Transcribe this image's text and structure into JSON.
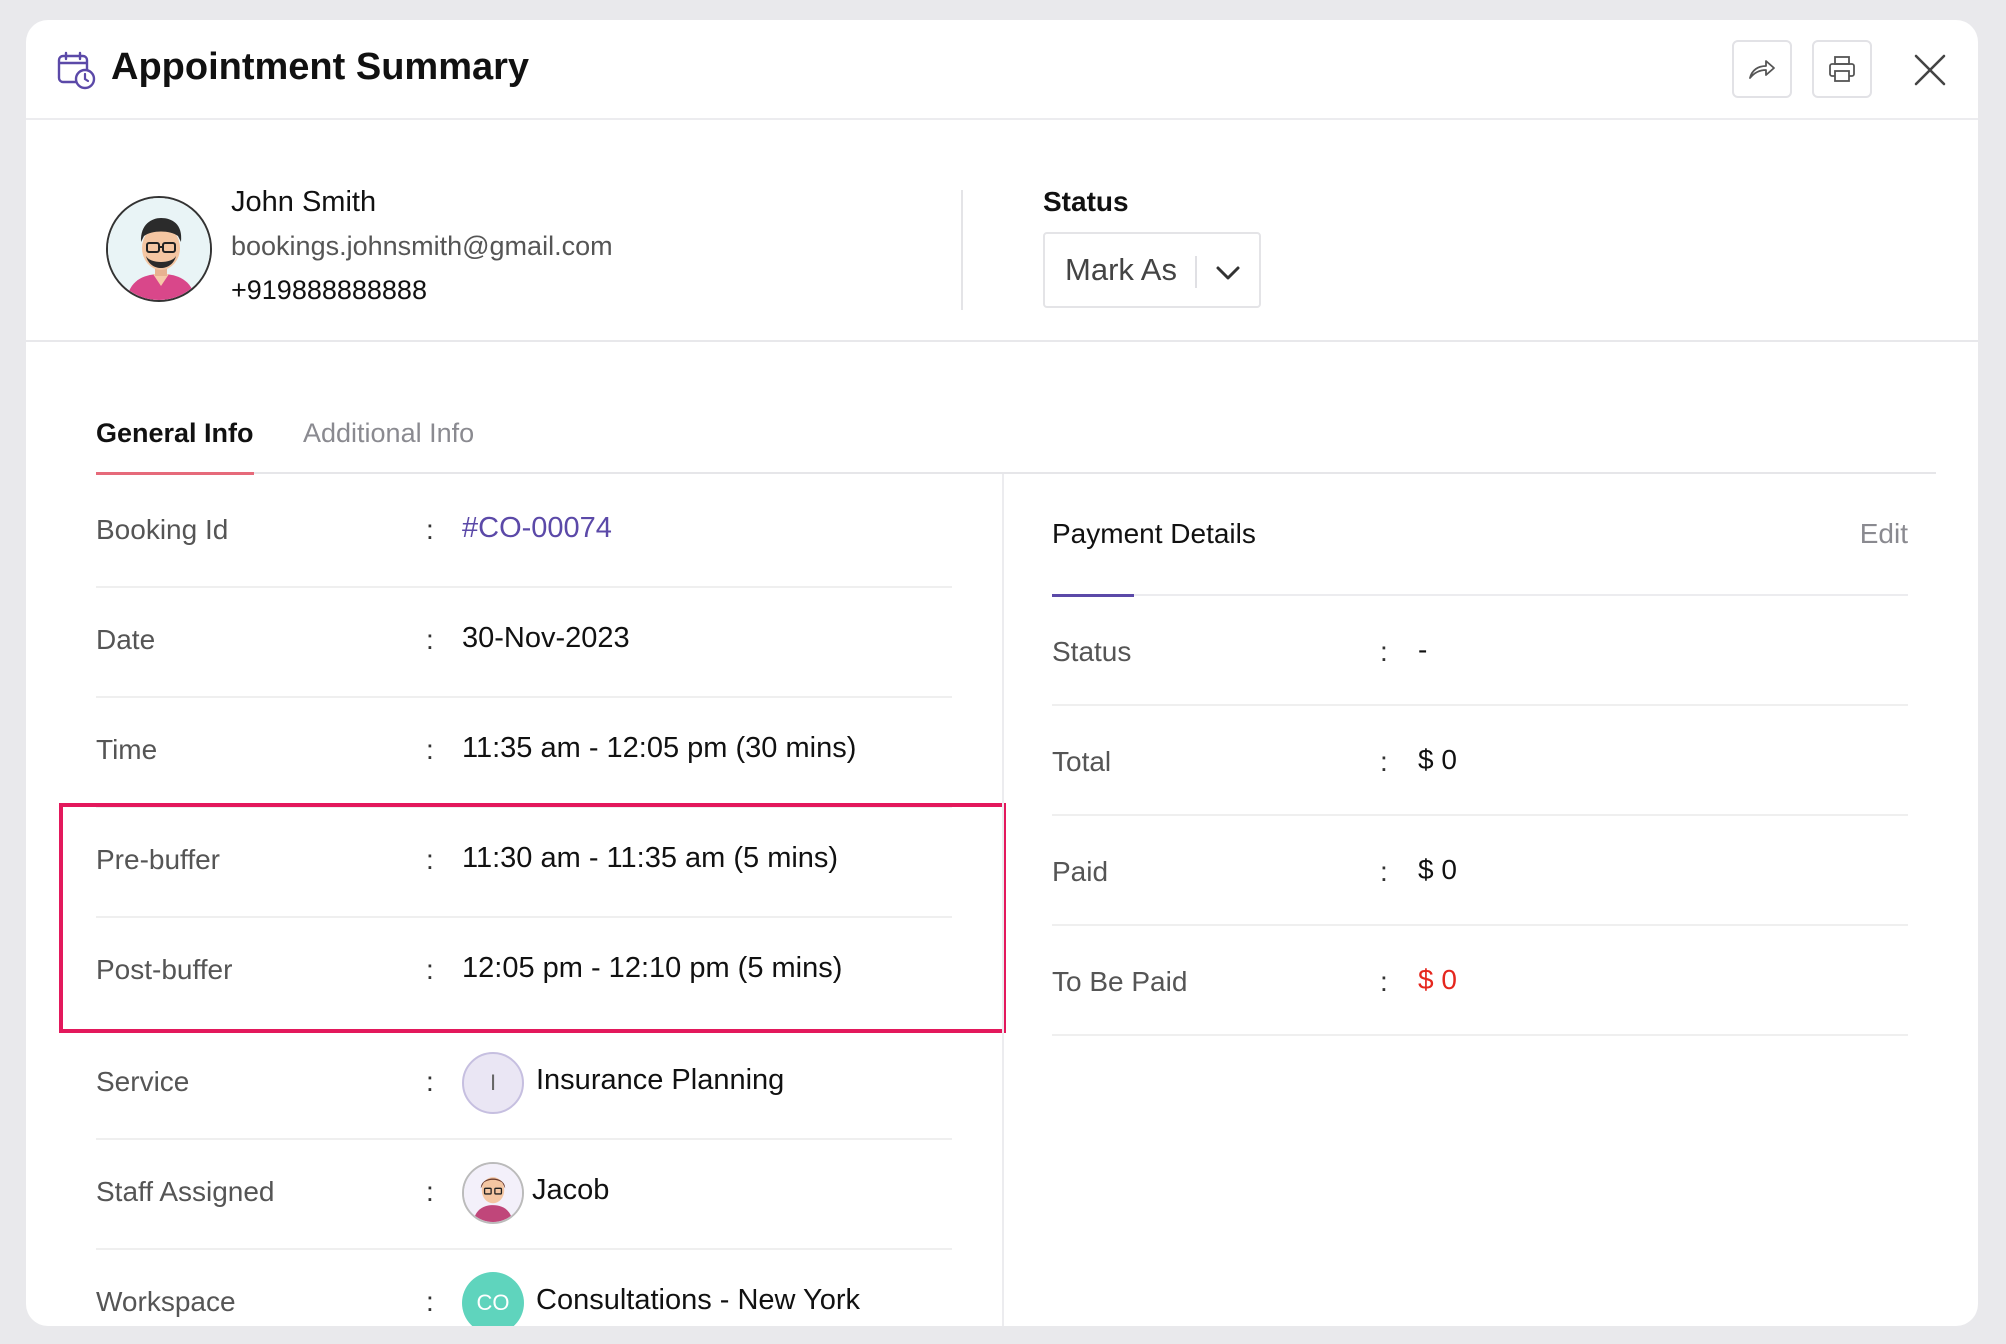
{
  "header": {
    "title": "Appointment Summary",
    "icons": [
      "calendar-clock-icon",
      "share-icon",
      "print-icon",
      "close-icon"
    ]
  },
  "customer": {
    "name": "John Smith",
    "email": "bookings.johnsmith@gmail.com",
    "phone": "+919888888888"
  },
  "status": {
    "label": "Status",
    "mark_as": "Mark As"
  },
  "tabs": [
    {
      "label": "General Info",
      "active": true
    },
    {
      "label": "Additional Info",
      "active": false
    }
  ],
  "general": {
    "rows": [
      {
        "label": "Booking Id",
        "value": "#CO-00074"
      },
      {
        "label": "Date",
        "value": "30-Nov-2023"
      },
      {
        "label": "Time",
        "value": "11:35 am - 12:05 pm (30 mins)"
      },
      {
        "label": "Pre-buffer",
        "value": "11:30 am - 11:35 am (5 mins)"
      },
      {
        "label": "Post-buffer",
        "value": "12:05 pm - 12:10 pm (5 mins)"
      },
      {
        "label": "Service",
        "value": "Insurance Planning",
        "badge": "I"
      },
      {
        "label": "Staff Assigned",
        "value": "Jacob"
      },
      {
        "label": "Workspace",
        "value": "Consultations - New York",
        "badge": "CO"
      }
    ],
    "colon": ":"
  },
  "payment": {
    "title": "Payment Details",
    "edit": "Edit",
    "rows": [
      {
        "label": "Status",
        "value": "-"
      },
      {
        "label": "Total",
        "value": "$ 0"
      },
      {
        "label": "Paid",
        "value": "$ 0"
      },
      {
        "label": "To Be Paid",
        "value": "$ 0"
      }
    ]
  },
  "colors": {
    "accent": "#5b49a8",
    "highlight": "#e3185c",
    "tab_underline": "#e66a7a",
    "due": "#e5271e",
    "workspace_badge": "#5fd4bd"
  }
}
